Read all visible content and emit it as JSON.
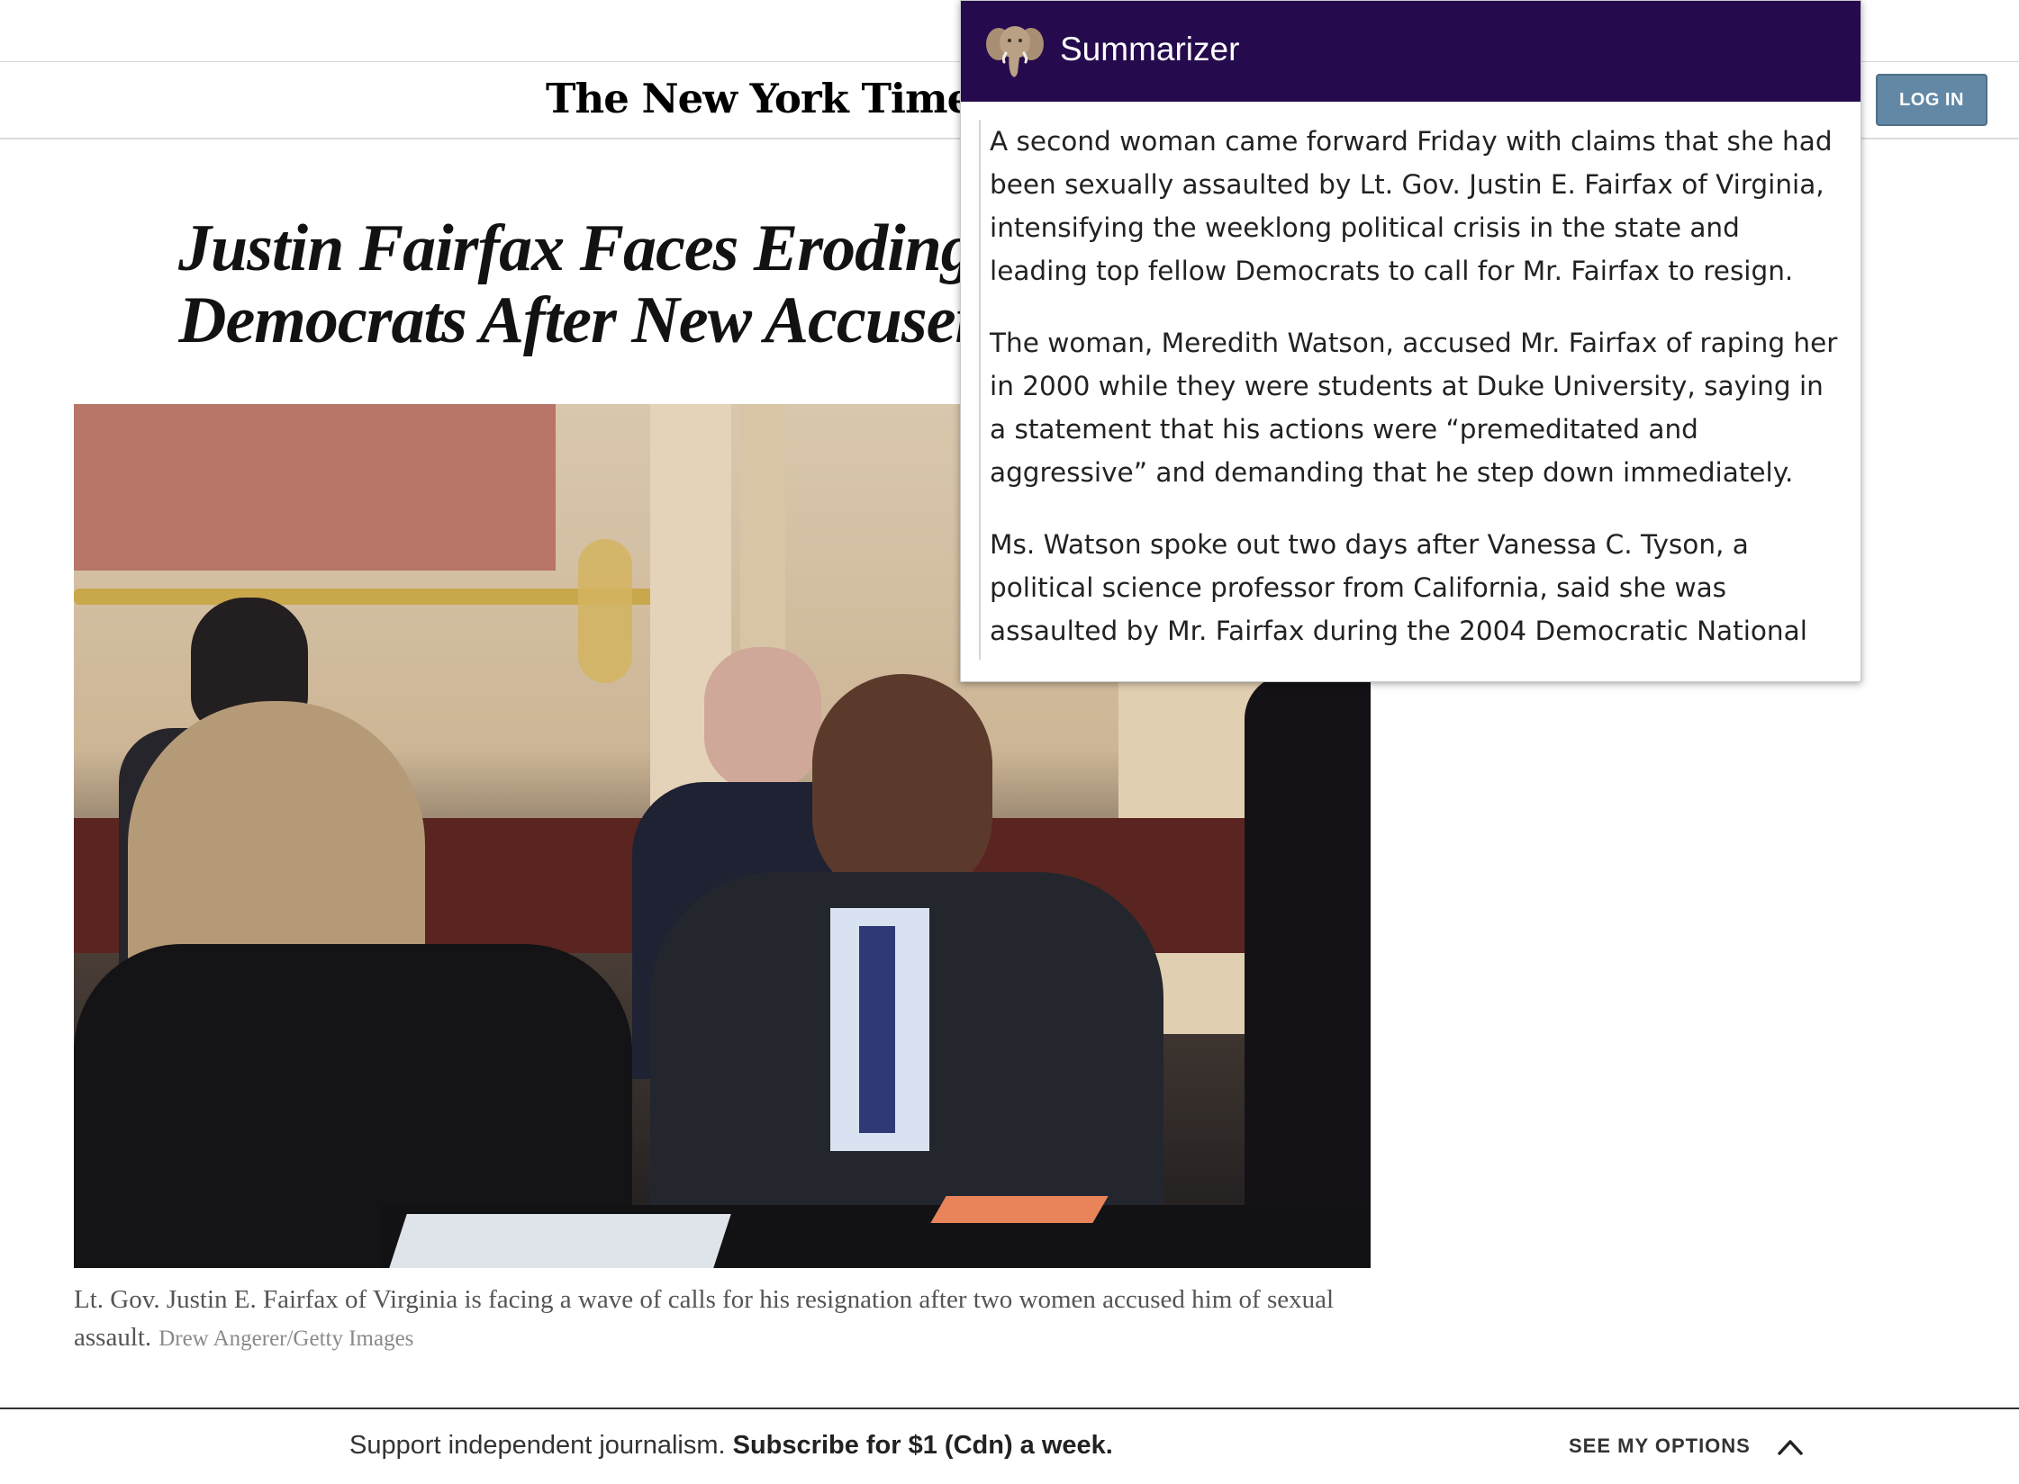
{
  "nyt": {
    "logo": "The New York Times",
    "login_label": "LOG IN",
    "headline_line1": "Justin Fairfax Faces Eroding Support From",
    "headline_line2": "Democrats After New Accuser Steps Forward",
    "caption": "Lt. Gov. Justin E. Fairfax of Virginia is facing a wave of calls for his resignation after two women accused him of sexual assault.",
    "credit": "Drew Angerer/Getty Images"
  },
  "subscribe": {
    "text": "Support independent journalism.",
    "offer": "Subscribe for $1 (Cdn) a week.",
    "options_label": "SEE MY OPTIONS",
    "options_icon": "chevron-up-icon"
  },
  "summarizer": {
    "title": "Summarizer",
    "icon": "elephant-icon",
    "header_color": "#250b4d",
    "paragraphs": [
      "A second woman came forward Friday with claims that she had been sexually assaulted by Lt. Gov. Justin E. Fairfax of Virginia, intensifying the weeklong political crisis in the state and leading top fellow Democrats to call for Mr. Fairfax to resign.",
      "The woman, Meredith Watson, accused Mr. Fairfax of raping her in 2000 while they were students at Duke University, saying in a statement that his actions were “premeditated and aggressive” and demanding that he step down immediately.",
      "Ms. Watson spoke out two days after Vanessa C. Tyson, a political science professor from California, said she was assaulted by Mr. Fairfax during the 2004 Democratic National"
    ]
  }
}
